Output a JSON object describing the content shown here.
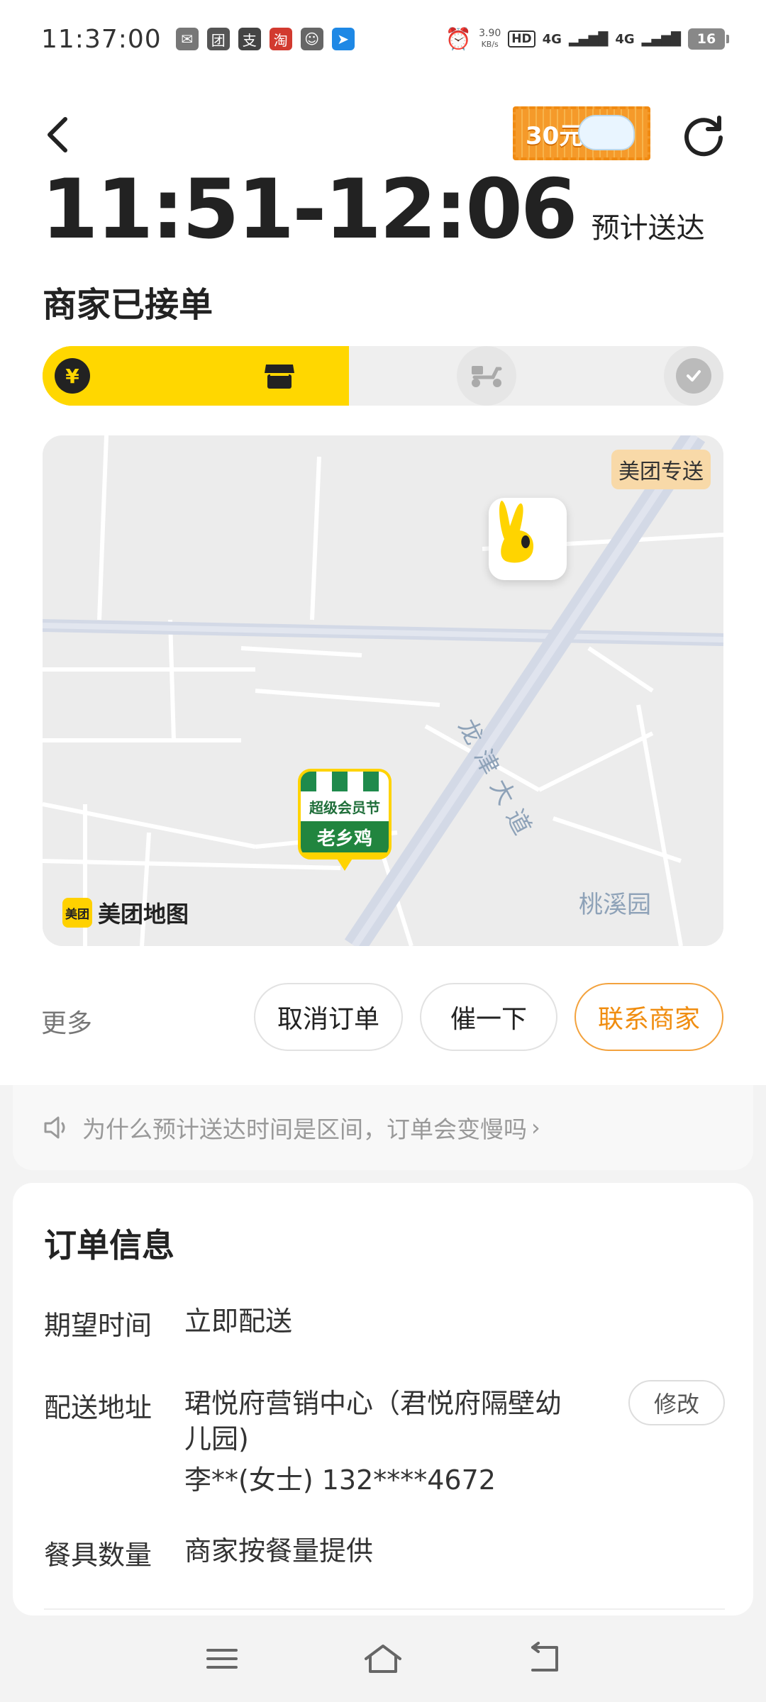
{
  "status_bar": {
    "time": "11:37:00",
    "notification_icons": [
      "wechat-pay-icon",
      "meituan-icon",
      "alipay-icon",
      "taobao-icon",
      "wechat-icon",
      "message-icon"
    ],
    "net_speed_value": "3.90",
    "net_speed_unit": "KB/s",
    "hd_badge": "HD",
    "sim_slots": "1 2",
    "net_type_1": "4G",
    "net_type_2": "4G",
    "battery": "16"
  },
  "header": {
    "promo_text": "30元",
    "eta": "11:51-12:06",
    "eta_label": "预计送达",
    "status": "商家已接单"
  },
  "progress": {
    "fraction_complete": 0.45,
    "steps": [
      {
        "name": "paid",
        "icon": "yen-icon",
        "active": true
      },
      {
        "name": "merchant",
        "icon": "store-icon",
        "active": true
      },
      {
        "name": "delivering",
        "icon": "scooter-icon",
        "active": false
      },
      {
        "name": "delivered",
        "icon": "check-shield-icon",
        "active": false
      }
    ]
  },
  "map": {
    "badge": "美团专送",
    "logo_box": "美团",
    "logo_text": "美团地图",
    "road_label": "龙津大道",
    "place_label": "桃溪园",
    "shop_banner_top": "老乡鸡",
    "shop_banner": "超级会员节",
    "shop_name": "老乡鸡"
  },
  "actions": {
    "more": "更多",
    "cancel": "取消订单",
    "urge": "催一下",
    "contact": "联系商家"
  },
  "notice": {
    "text": "为什么预计送达时间是区间，订单会变慢吗",
    "arrow": "›"
  },
  "order_info": {
    "title": "订单信息",
    "expected_time_label": "期望时间",
    "expected_time_value": "立即配送",
    "address_label": "配送地址",
    "address_line1": "珺悦府营销中心（君悦府隔壁幼",
    "address_line2": "儿园)",
    "contact_line": "李**(女士)  132****4672",
    "edit": "修改",
    "tableware_label": "餐具数量",
    "tableware_value": "商家按餐量提供"
  },
  "colors": {
    "accent_yellow": "#ffd700",
    "accent_orange": "#f08d10",
    "map_bg": "#ececec",
    "road": "#d6dce8"
  }
}
